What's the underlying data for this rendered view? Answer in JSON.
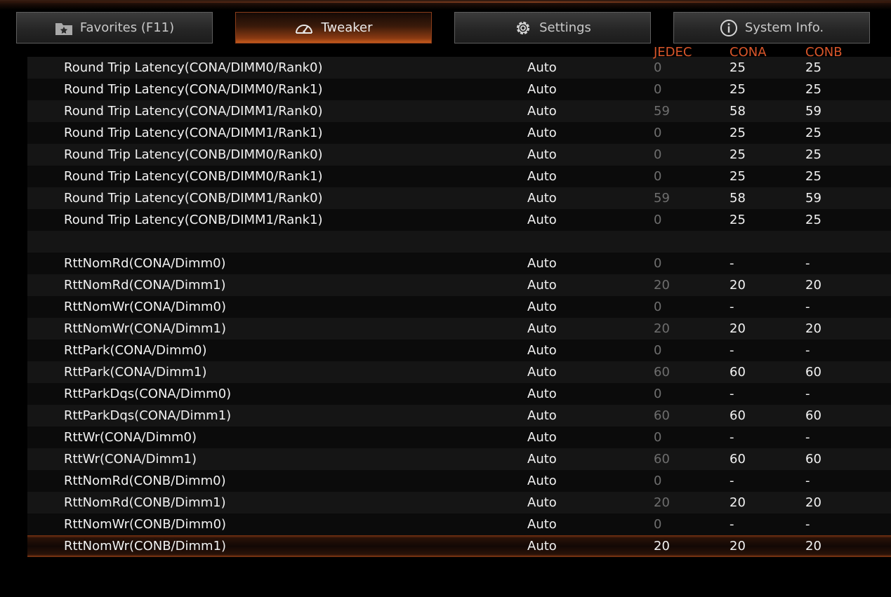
{
  "tabs": [
    {
      "label": "Favorites (F11)",
      "icon": "favorites-star-icon",
      "active": false
    },
    {
      "label": "Tweaker",
      "icon": "speedometer-icon",
      "active": true
    },
    {
      "label": "Settings",
      "icon": "gear-icon",
      "active": false
    },
    {
      "label": "System Info.",
      "icon": "info-icon",
      "active": false
    }
  ],
  "columns": {
    "jedec": "JEDEC",
    "cona": "CONA",
    "conb": "CONB"
  },
  "colors": {
    "accent": "#d9562a",
    "muted_value": "#6e6e6e"
  },
  "rows": [
    {
      "name": "Round Trip Latency(CONA/DIMM0/Rank0)",
      "value": "Auto",
      "jedec": "0",
      "cona": "25",
      "conb": "25"
    },
    {
      "name": "Round Trip Latency(CONA/DIMM0/Rank1)",
      "value": "Auto",
      "jedec": "0",
      "cona": "25",
      "conb": "25"
    },
    {
      "name": "Round Trip Latency(CONA/DIMM1/Rank0)",
      "value": "Auto",
      "jedec": "59",
      "cona": "58",
      "conb": "59"
    },
    {
      "name": "Round Trip Latency(CONA/DIMM1/Rank1)",
      "value": "Auto",
      "jedec": "0",
      "cona": "25",
      "conb": "25"
    },
    {
      "name": "Round Trip Latency(CONB/DIMM0/Rank0)",
      "value": "Auto",
      "jedec": "0",
      "cona": "25",
      "conb": "25"
    },
    {
      "name": "Round Trip Latency(CONB/DIMM0/Rank1)",
      "value": "Auto",
      "jedec": "0",
      "cona": "25",
      "conb": "25"
    },
    {
      "name": "Round Trip Latency(CONB/DIMM1/Rank0)",
      "value": "Auto",
      "jedec": "59",
      "cona": "58",
      "conb": "59"
    },
    {
      "name": "Round Trip Latency(CONB/DIMM1/Rank1)",
      "value": "Auto",
      "jedec": "0",
      "cona": "25",
      "conb": "25"
    },
    {
      "name": "",
      "value": "",
      "jedec": "",
      "cona": "",
      "conb": ""
    },
    {
      "name": "RttNomRd(CONA/Dimm0)",
      "value": "Auto",
      "jedec": "0",
      "cona": "-",
      "conb": "-"
    },
    {
      "name": "RttNomRd(CONA/Dimm1)",
      "value": "Auto",
      "jedec": "20",
      "cona": "20",
      "conb": "20"
    },
    {
      "name": "RttNomWr(CONA/Dimm0)",
      "value": "Auto",
      "jedec": "0",
      "cona": "-",
      "conb": "-"
    },
    {
      "name": "RttNomWr(CONA/Dimm1)",
      "value": "Auto",
      "jedec": "20",
      "cona": "20",
      "conb": "20"
    },
    {
      "name": "RttPark(CONA/Dimm0)",
      "value": "Auto",
      "jedec": "0",
      "cona": "-",
      "conb": "-"
    },
    {
      "name": "RttPark(CONA/Dimm1)",
      "value": "Auto",
      "jedec": "60",
      "cona": "60",
      "conb": "60"
    },
    {
      "name": "RttParkDqs(CONA/Dimm0)",
      "value": "Auto",
      "jedec": "0",
      "cona": "-",
      "conb": "-"
    },
    {
      "name": "RttParkDqs(CONA/Dimm1)",
      "value": "Auto",
      "jedec": "60",
      "cona": "60",
      "conb": "60"
    },
    {
      "name": "RttWr(CONA/Dimm0)",
      "value": "Auto",
      "jedec": "0",
      "cona": "-",
      "conb": "-"
    },
    {
      "name": "RttWr(CONA/Dimm1)",
      "value": "Auto",
      "jedec": "60",
      "cona": "60",
      "conb": "60"
    },
    {
      "name": "RttNomRd(CONB/Dimm0)",
      "value": "Auto",
      "jedec": "0",
      "cona": "-",
      "conb": "-"
    },
    {
      "name": "RttNomRd(CONB/Dimm1)",
      "value": "Auto",
      "jedec": "20",
      "cona": "20",
      "conb": "20"
    },
    {
      "name": "RttNomWr(CONB/Dimm0)",
      "value": "Auto",
      "jedec": "0",
      "cona": "-",
      "conb": "-"
    },
    {
      "name": "RttNomWr(CONB/Dimm1)",
      "value": "Auto",
      "jedec": "20",
      "cona": "20",
      "conb": "20",
      "selected": true
    }
  ]
}
